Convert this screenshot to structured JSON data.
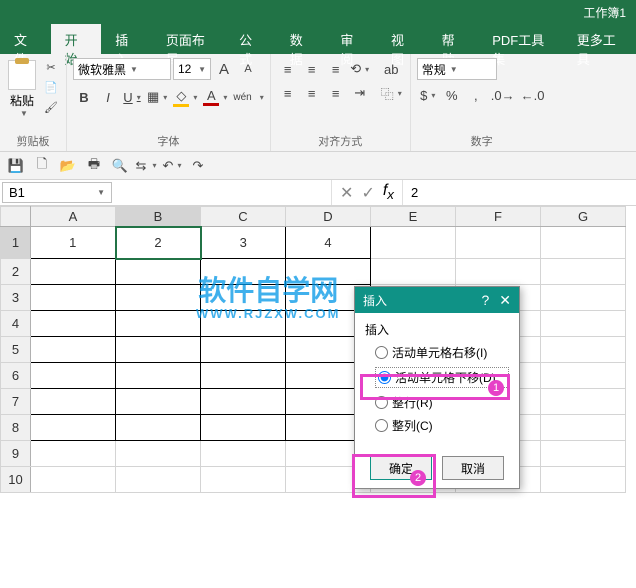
{
  "title": "工作簿1",
  "tabs": [
    "文件",
    "开始",
    "插入",
    "页面布局",
    "公式",
    "数据",
    "审阅",
    "视图",
    "帮助",
    "PDF工具集",
    "更多工具"
  ],
  "active_tab_index": 1,
  "clipboard": {
    "paste": "粘贴",
    "label": "剪贴板"
  },
  "font": {
    "name": "微软雅黑",
    "size": "12",
    "label": "字体",
    "increase": "A",
    "decrease": "A",
    "bold": "B",
    "italic": "I",
    "underline": "U",
    "ruby": "wén"
  },
  "align": {
    "label": "对齐方式",
    "wrap": "ab",
    "merge": "⿻"
  },
  "number": {
    "preset": "常规",
    "label": "数字"
  },
  "qat": [
    "💾",
    "🗋",
    "📂",
    "🖶",
    "🔍",
    "⇆",
    "↶",
    "↷"
  ],
  "name_box": "B1",
  "formula_value": "2",
  "cols": [
    "A",
    "B",
    "C",
    "D",
    "E",
    "F",
    "G"
  ],
  "rows": [
    "1",
    "2",
    "3",
    "4",
    "5",
    "6",
    "7",
    "8",
    "9",
    "10"
  ],
  "cells": {
    "A1": "1",
    "B1": "2",
    "C1": "3",
    "D1": "4"
  },
  "selected_cell": "B1",
  "watermark": {
    "main": "软件自学网",
    "sub": "WWW.RJZXW.COM"
  },
  "dialog": {
    "title": "插入",
    "group": "插入",
    "options": [
      "活动单元格右移(I)",
      "活动单元格下移(D)",
      "整行(R)",
      "整列(C)"
    ],
    "selected_index": 1,
    "ok": "确定",
    "cancel": "取消"
  },
  "annotations": {
    "badge1": "1",
    "badge2": "2"
  }
}
